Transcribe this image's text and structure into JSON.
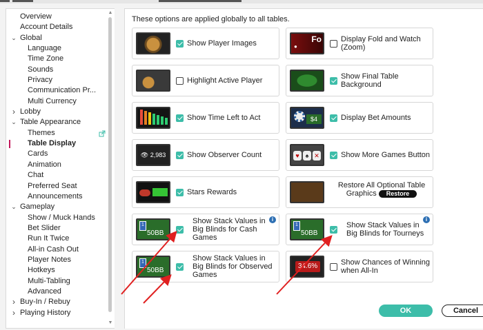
{
  "sidebar": {
    "items": [
      {
        "label": "Overview",
        "level": 0
      },
      {
        "label": "Account Details",
        "level": 0
      },
      {
        "label": "Global",
        "level": 0,
        "expander": "down"
      },
      {
        "label": "Language",
        "level": 1
      },
      {
        "label": "Time Zone",
        "level": 1
      },
      {
        "label": "Sounds",
        "level": 1
      },
      {
        "label": "Privacy",
        "level": 1
      },
      {
        "label": "Communication Pr...",
        "level": 1
      },
      {
        "label": "Multi Currency",
        "level": 1
      },
      {
        "label": "Lobby",
        "level": 0,
        "expander": "right"
      },
      {
        "label": "Table Appearance",
        "level": 0,
        "expander": "down"
      },
      {
        "label": "Themes",
        "level": 1,
        "external": true
      },
      {
        "label": "Table Display",
        "level": 1,
        "selected": true
      },
      {
        "label": "Cards",
        "level": 1
      },
      {
        "label": "Animation",
        "level": 1
      },
      {
        "label": "Chat",
        "level": 1
      },
      {
        "label": "Preferred Seat",
        "level": 1
      },
      {
        "label": "Announcements",
        "level": 1
      },
      {
        "label": "Gameplay",
        "level": 0,
        "expander": "down"
      },
      {
        "label": "Show / Muck Hands",
        "level": 1
      },
      {
        "label": "Bet Slider",
        "level": 1
      },
      {
        "label": "Run It Twice",
        "level": 1
      },
      {
        "label": "All-in Cash Out",
        "level": 1
      },
      {
        "label": "Player Notes",
        "level": 1
      },
      {
        "label": "Hotkeys",
        "level": 1
      },
      {
        "label": "Multi-Tabling",
        "level": 1
      },
      {
        "label": "Advanced",
        "level": 1
      },
      {
        "label": "Buy-In / Rebuy",
        "level": 0,
        "expander": "right"
      },
      {
        "label": "Playing History",
        "level": 0,
        "expander": "right"
      }
    ]
  },
  "main": {
    "intro": "These options are applied globally to all tables.",
    "options": [
      {
        "id": "player-images",
        "label": "Show Player Images",
        "checked": true,
        "thumb": "tiger"
      },
      {
        "id": "fold-watch",
        "label": "Display Fold and Watch (Zoom)",
        "checked": false,
        "thumb": "fold",
        "thumb_text": "Fo"
      },
      {
        "id": "highlight-active",
        "label": "Highlight Active Player",
        "checked": false,
        "thumb": "highlight"
      },
      {
        "id": "final-table-bg",
        "label": "Show Final Table Background",
        "checked": true,
        "thumb": "final"
      },
      {
        "id": "time-left",
        "label": "Show Time Left to Act",
        "checked": true,
        "thumb": "time"
      },
      {
        "id": "bet-amounts",
        "label": "Display Bet Amounts",
        "checked": true,
        "thumb": "bet",
        "thumb_text": "$4"
      },
      {
        "id": "observer-count",
        "label": "Show Observer Count",
        "checked": true,
        "thumb": "obs",
        "thumb_text": "2,983"
      },
      {
        "id": "more-games",
        "label": "Show More Games Button",
        "checked": true,
        "thumb": "more"
      },
      {
        "id": "stars-rewards",
        "label": "Stars Rewards",
        "checked": true,
        "thumb": "stars"
      },
      {
        "id": "restore-graphics",
        "label": "Restore All Optional Table Graphics",
        "button": "Restore",
        "thumb": "restore"
      },
      {
        "id": "stack-bb-cash",
        "label": "Show Stack Values in Big Blinds for Cash Games",
        "checked": true,
        "thumb": "stack",
        "thumb_text": "50BB",
        "info": true
      },
      {
        "id": "stack-bb-tourney",
        "label": "Show Stack Values in Big Blinds for Tourneys",
        "checked": true,
        "thumb": "stack",
        "thumb_text": "50BB",
        "info": true
      },
      {
        "id": "stack-bb-observed",
        "label": "Show Stack Values in Big Blinds for Observed Games",
        "checked": true,
        "thumb": "stack",
        "thumb_text": "50BB"
      },
      {
        "id": "chances-winning",
        "label": "Show Chances of Winning when All-In",
        "checked": false,
        "thumb": "chance",
        "thumb_text": "34.6%"
      }
    ]
  },
  "footer": {
    "ok_label": "OK",
    "cancel_label": "Cancel"
  },
  "colors": {
    "accent": "#3dbda9",
    "selected_marker": "#c2185b",
    "annotation_arrow": "#e02020",
    "info": "#2d6fb3"
  }
}
